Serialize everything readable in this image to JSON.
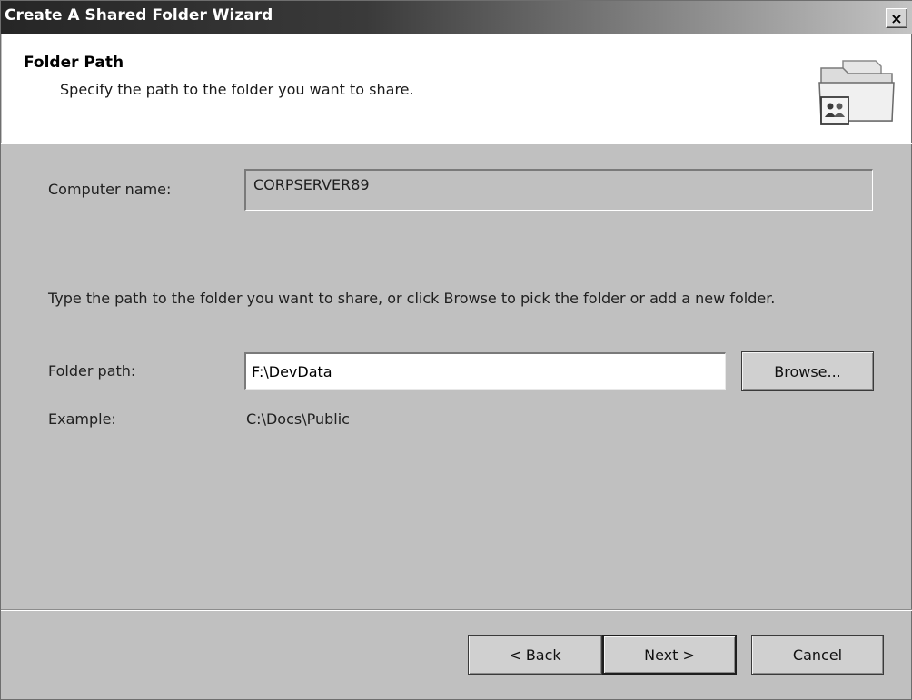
{
  "window": {
    "title": "Create A Shared Folder Wizard",
    "close_glyph": "×"
  },
  "header": {
    "title": "Folder Path",
    "subtitle": "Specify the path to the folder you want to share.",
    "icon": "shared-folder-icon"
  },
  "form": {
    "computer_name_label": "Computer name:",
    "computer_name_value": "CORPSERVER89",
    "instruction": "Type the path to the folder you want to share, or click Browse to pick the folder or add a new folder.",
    "folder_path_label": "Folder path:",
    "folder_path_value": "F:\\DevData",
    "browse_label": "Browse...",
    "example_label": "Example:",
    "example_value": "C:\\Docs\\Public"
  },
  "footer": {
    "back_label": "< Back",
    "next_label": "Next >",
    "cancel_label": "Cancel"
  }
}
